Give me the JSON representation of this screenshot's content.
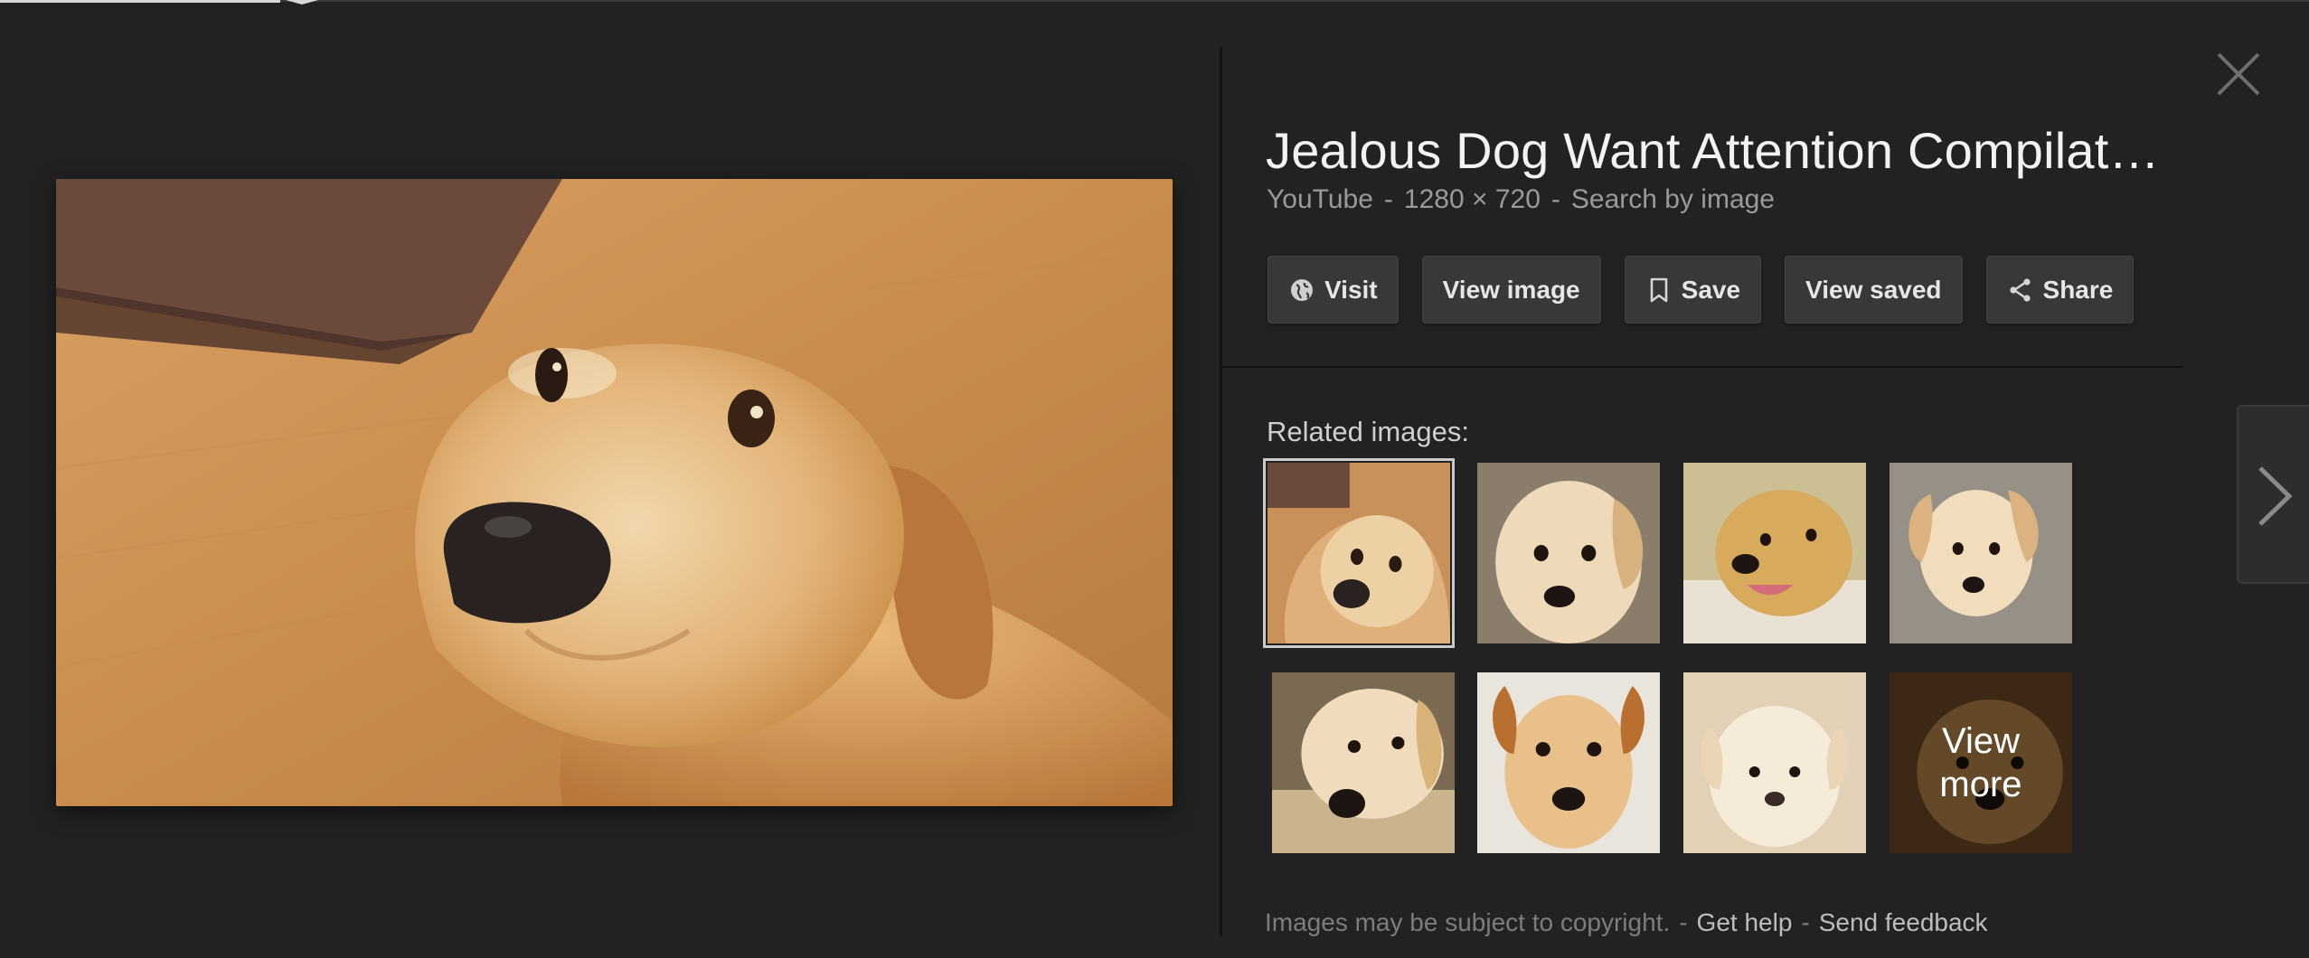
{
  "title": "Jealous Dog Want Attention Compilat…",
  "meta": {
    "source": "YouTube",
    "separator": "-",
    "dimensions": "1280 × 720",
    "search_by_image": "Search by image"
  },
  "actions": [
    {
      "label": "Visit",
      "icon": "globe-icon"
    },
    {
      "label": "View image",
      "icon": ""
    },
    {
      "label": "Save",
      "icon": "bookmark-icon"
    },
    {
      "label": "View saved",
      "icon": ""
    },
    {
      "label": "Share",
      "icon": "share-icon"
    }
  ],
  "related": {
    "label": "Related images:",
    "view_more": "View more",
    "thumbnail_count": 8,
    "selected_index": 0
  },
  "footer": {
    "copyright": "Images may be subject to copyright.",
    "separator": "-",
    "get_help": "Get help",
    "send_feedback": "Send feedback"
  },
  "icons": {
    "close": "close-icon",
    "next": "chevron-right-icon"
  },
  "colors": {
    "background": "#222222",
    "button": "#383838",
    "muted_text": "#9a9a9a",
    "title_text": "#f2f2f2"
  }
}
